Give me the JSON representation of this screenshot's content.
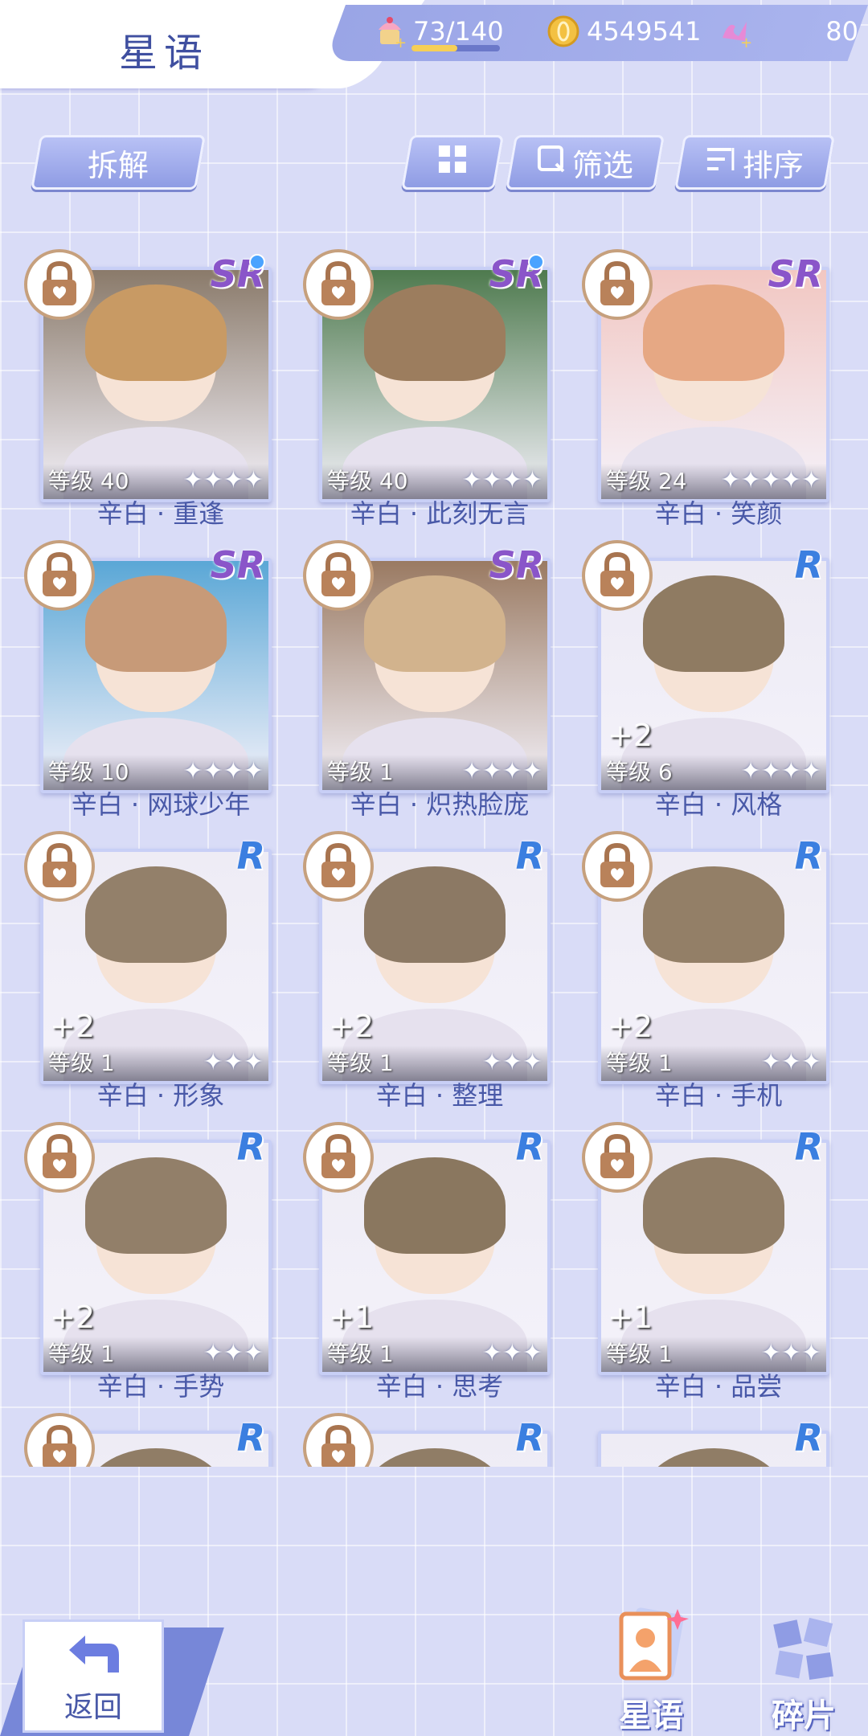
{
  "header": {
    "title": "星语",
    "stamina": {
      "value": "73/140",
      "fill": 0.52
    },
    "gold": "4549541",
    "gems": "80"
  },
  "toolbar": {
    "decompose_label": "拆解",
    "filter_label": "筛选",
    "sort_label": "排序"
  },
  "cards": [
    {
      "name": "辛白 · 重逢",
      "rarity": "SR",
      "level": "等级 40",
      "stars": "✦✦✦✦",
      "plus": "",
      "hair": "#c89a64",
      "bg": "#8a7a6a",
      "new": true
    },
    {
      "name": "辛白 · 此刻无言",
      "rarity": "SR",
      "level": "等级 40",
      "stars": "✦✦✦✦",
      "plus": "",
      "hair": "#9c7d5e",
      "bg": "#4e7a4e",
      "new": true
    },
    {
      "name": "辛白 · 笑颜",
      "rarity": "SR",
      "level": "等级 24",
      "stars": "✦✦✦✦✦",
      "plus": "",
      "hair": "#e6a884",
      "bg": "#f2c7c2",
      "new": false
    },
    {
      "name": "辛白 · 网球少年",
      "rarity": "SR",
      "level": "等级 10",
      "stars": "✦✦✦✦",
      "plus": "",
      "hair": "#c79a78",
      "bg": "#5aa7d6",
      "new": false
    },
    {
      "name": "辛白 · 炽热脸庞",
      "rarity": "SR",
      "level": "等级 1",
      "stars": "✦✦✦✦",
      "plus": "",
      "hair": "#d2b38d",
      "bg": "#9a7a62",
      "new": false
    },
    {
      "name": "辛白 · 风格",
      "rarity": "R",
      "level": "等级 6",
      "stars": "✦✦✦✦",
      "plus": "+2",
      "hair": "#8f7b62",
      "bg": "#eceaf4",
      "new": false
    },
    {
      "name": "辛白 · 形象",
      "rarity": "R",
      "level": "等级 1",
      "stars": "✦✦✦",
      "plus": "+2",
      "hair": "#93806a",
      "bg": "#eeecf5",
      "new": false
    },
    {
      "name": "辛白 · 整理",
      "rarity": "R",
      "level": "等级 1",
      "stars": "✦✦✦",
      "plus": "+2",
      "hair": "#8c7964",
      "bg": "#eeecf5",
      "new": false
    },
    {
      "name": "辛白 · 手机",
      "rarity": "R",
      "level": "等级 1",
      "stars": "✦✦✦",
      "plus": "+2",
      "hair": "#937f67",
      "bg": "#eeecf5",
      "new": false
    },
    {
      "name": "辛白 · 手势",
      "rarity": "R",
      "level": "等级 1",
      "stars": "✦✦✦",
      "plus": "+2",
      "hair": "#927f69",
      "bg": "#eeecf5",
      "new": false
    },
    {
      "name": "辛白 · 思考",
      "rarity": "R",
      "level": "等级 1",
      "stars": "✦✦✦",
      "plus": "+1",
      "hair": "#8a775f",
      "bg": "#eeecf5",
      "new": false
    },
    {
      "name": "辛白 · 品尝",
      "rarity": "R",
      "level": "等级 1",
      "stars": "✦✦✦",
      "plus": "+1",
      "hair": "#907d66",
      "bg": "#eeecf5",
      "new": false
    },
    {
      "name": "",
      "rarity": "R",
      "level": "",
      "stars": "",
      "plus": "",
      "hair": "#907d66",
      "bg": "#eeecf5",
      "new": false
    },
    {
      "name": "",
      "rarity": "R",
      "level": "",
      "stars": "",
      "plus": "",
      "hair": "#907d66",
      "bg": "#eeecf5",
      "new": false
    },
    {
      "name": "",
      "rarity": "R",
      "level": "",
      "stars": "",
      "plus": "",
      "hair": "#907d66",
      "bg": "#eeecf5",
      "new": false,
      "locked": false
    }
  ],
  "nav": {
    "back_label": "返回",
    "stars_label": "星语",
    "fragments_label": "碎片"
  },
  "colors": {
    "accent": "#4959a8",
    "panel": "#9aa5e6",
    "sr": "#8a55c9",
    "r": "#3b7fe0"
  }
}
